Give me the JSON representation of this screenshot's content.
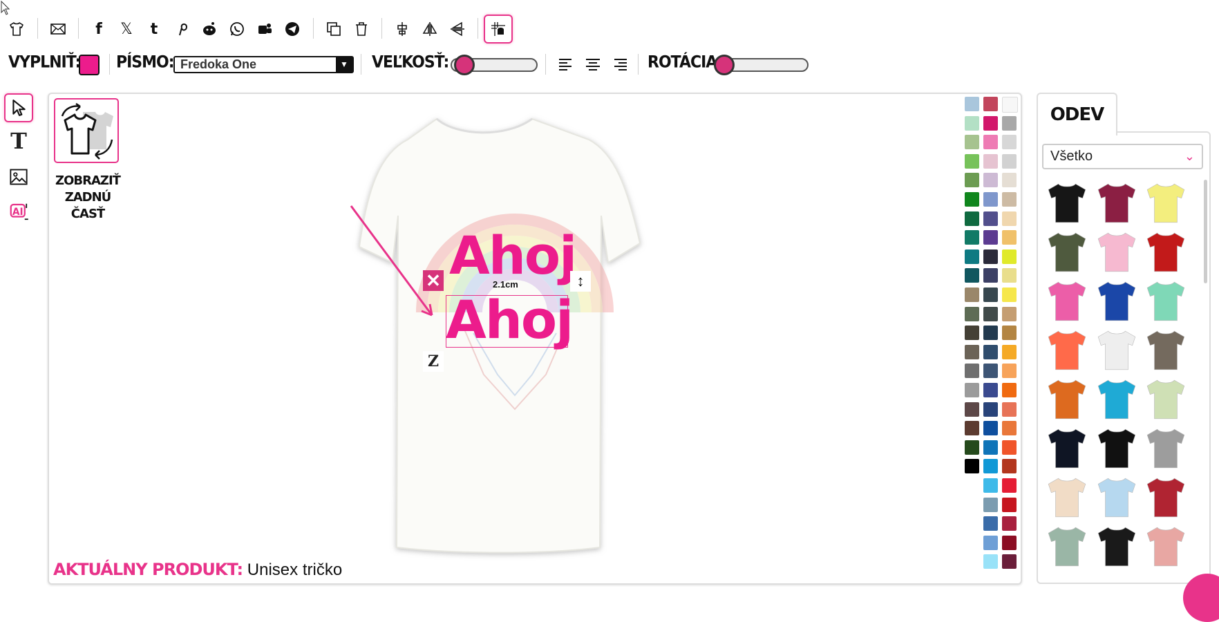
{
  "toolbar": {
    "icons": [
      "tshirt-icon",
      "mail-icon",
      "facebook-icon",
      "x-icon",
      "tumblr-icon",
      "pinterest-icon",
      "reddit-icon",
      "whatsapp-icon",
      "teams-icon",
      "telegram-icon",
      "duplicate-icon",
      "trash-icon",
      "center-align-icon",
      "flip-horizontal-icon",
      "flip-vertical-icon",
      "grid-icon"
    ]
  },
  "options": {
    "fill_label": "VYPLNIŤ:",
    "fill_color": "#ec1c8c",
    "font_label": "PÍSMO:",
    "font_value": "Fredoka One",
    "size_label": "VEĽKOSŤ:",
    "size_level": 0.05,
    "rotation_label": "ROTÁCIA:",
    "rotation_level": 0.0
  },
  "canvas": {
    "back_label": "ZOBRAZIŤ ZADNÚ ČASŤ",
    "text_top": "Ahoj",
    "text_selected": "Ahoj",
    "measure": "2.1cm",
    "product_key": "AKTUÁLNY PRODUKT:",
    "product_value": "Unisex tričko",
    "accent": "#e8338a"
  },
  "palette": {
    "col1": [
      "#a9c6dc",
      "#b3e0c5",
      "#a6c38f",
      "#77c25a",
      "#6c9c52",
      "#10861d",
      "#0f6a40",
      "#127a66",
      "#0e7a82",
      "#11575f",
      "#9a876a",
      "#5e6c55",
      "#444035",
      "#6b6357",
      "#6f6f6f",
      "#9b9b9b",
      "#5d4848",
      "#5c3b30",
      "#254a1c",
      "#000000"
    ],
    "col2": [
      "#c2455c",
      "#d2176b",
      "#ee7bb4",
      "#e6c3d1",
      "#cdbad4",
      "#7f97cc",
      "#524f8c",
      "#5c3b91",
      "#2b2a3a",
      "#3c4065",
      "#37474f",
      "#414b4a",
      "#223a4f",
      "#2f4d6d",
      "#3d5575",
      "#3a4a8f",
      "#29447a",
      "#0f4f9e",
      "#0f74b8",
      "#1199d6",
      "#3ebae9",
      "#7b9cb0",
      "#3a6ca9",
      "#6e9fd6",
      "#99e2f8"
    ],
    "col3": [
      "#f7f7f7",
      "#a8a8a8",
      "#d7d7d7",
      "#d2d2d2",
      "#e5ded4",
      "#cdbba4",
      "#f0d7ae",
      "#f0c16a",
      "#e0ea2a",
      "#e9de8c",
      "#f6e74b",
      "#c59e72",
      "#b38543",
      "#f5aa26",
      "#f7a35a",
      "#f06a10",
      "#e77357",
      "#e9773a",
      "#f0552a",
      "#b3361e",
      "#e51d35",
      "#c6151f",
      "#a8203e",
      "#8c0d23",
      "#6b1e3a"
    ]
  },
  "panel": {
    "tab_label": "ODEV",
    "filter_value": "Všetko",
    "shirts": [
      "#161616",
      "#8b1f43",
      "#f3ee7e",
      "#4f5a3e",
      "#f6b9d0",
      "#c21a1a",
      "#ec5ea8",
      "#1b47a8",
      "#7fd8b7",
      "#ff6a4a",
      "#eeeeee",
      "#746a5e",
      "#dd6a1f",
      "#1faad5",
      "#cfe0b5",
      "#0f1524",
      "#111111",
      "#9d9d9d",
      "#f1dcc6",
      "#b6d8ef",
      "#b02432",
      "#9ab6a6",
      "#1a1a1a",
      "#e8a7a3"
    ]
  }
}
